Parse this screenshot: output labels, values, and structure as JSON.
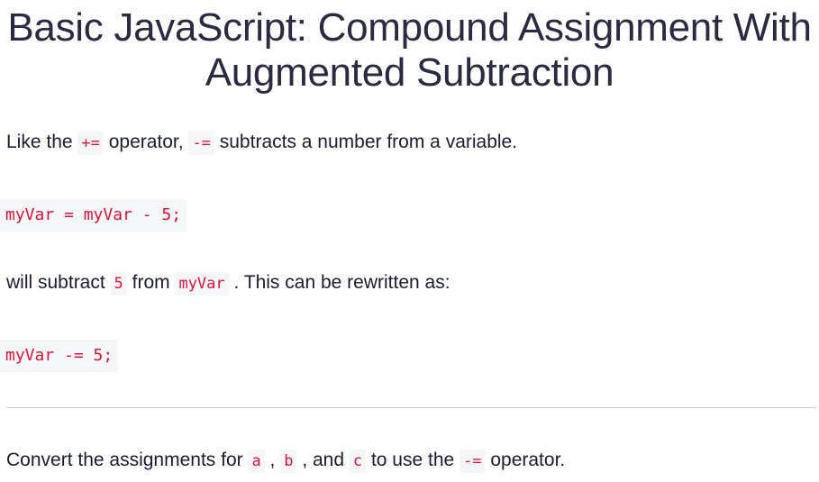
{
  "challenge": {
    "title_line1": "Basic JavaScript: Compound Assignment With",
    "title_line2": "Augmented Subtraction"
  },
  "description": {
    "p1": {
      "t1": "Like the ",
      "c1": "+=",
      "t2": " operator, ",
      "c2": "-=",
      "t3": " subtracts a number from a variable."
    },
    "code1": "myVar = myVar - 5;",
    "p2": {
      "t1": "will subtract ",
      "c1": "5",
      "t2": " from ",
      "c2": "myVar",
      "t3": " . This can be rewritten as:"
    },
    "code2": "myVar -= 5;"
  },
  "instructions": {
    "t1": "Convert the assignments for ",
    "c1": "a",
    "t2": " , ",
    "c2": "b",
    "t3": " , and ",
    "c3": "c",
    "t4": " to use the ",
    "c4": "-=",
    "t5": " operator."
  }
}
